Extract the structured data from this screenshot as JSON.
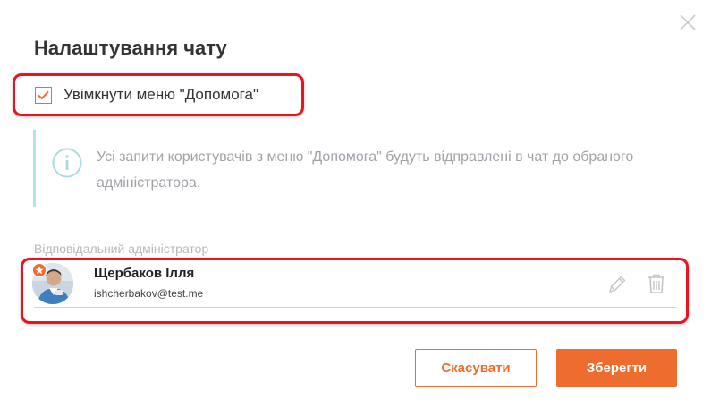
{
  "dialog": {
    "title": "Налаштування чату",
    "help_menu_toggle": {
      "label": "Увімкнути меню \"Допомога\"",
      "checked": true
    },
    "info": {
      "text": "Усі запити користувачів з меню \"Допомога\" будуть відправлені в чат до обраного адміністратора."
    },
    "responsible_admin": {
      "section_label": "Відповідальний адміністратор",
      "name": "Щербаков Ілля",
      "email": "ishcherbakov@test.me"
    },
    "buttons": {
      "cancel_label": "Скасувати",
      "save_label": "Зберегти"
    }
  },
  "colors": {
    "accent": "#ee6d2e",
    "highlight_border": "#e8141f",
    "info_border": "#b3e3e6",
    "info_text": "#9fa3a8"
  },
  "icons": {
    "close": "close-icon",
    "checkmark": "checkmark-icon",
    "info": "info-icon",
    "star_badge": "star-icon",
    "edit": "pencil-icon",
    "delete": "trash-icon"
  }
}
